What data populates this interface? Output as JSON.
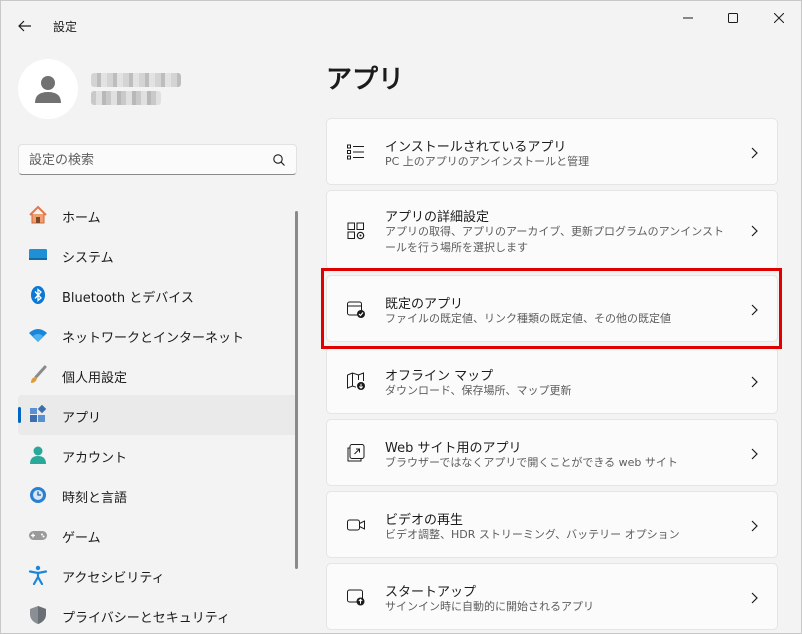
{
  "window": {
    "title": "設定"
  },
  "search": {
    "placeholder": "設定の検索"
  },
  "sidebar": {
    "items": [
      {
        "label": "ホーム",
        "icon": "home-icon"
      },
      {
        "label": "システム",
        "icon": "system-icon"
      },
      {
        "label": "Bluetooth とデバイス",
        "icon": "bluetooth-icon"
      },
      {
        "label": "ネットワークとインターネット",
        "icon": "wifi-icon"
      },
      {
        "label": "個人用設定",
        "icon": "brush-icon"
      },
      {
        "label": "アプリ",
        "icon": "apps-icon",
        "selected": true
      },
      {
        "label": "アカウント",
        "icon": "account-icon"
      },
      {
        "label": "時刻と言語",
        "icon": "clock-globe-icon"
      },
      {
        "label": "ゲーム",
        "icon": "gamepad-icon"
      },
      {
        "label": "アクセシビリティ",
        "icon": "accessibility-icon"
      },
      {
        "label": "プライバシーとセキュリティ",
        "icon": "shield-icon"
      }
    ]
  },
  "main": {
    "title": "アプリ",
    "cards": [
      {
        "title": "インストールされているアプリ",
        "desc": "PC 上のアプリのアンインストールと管理",
        "icon": "installed-apps-icon"
      },
      {
        "title": "アプリの詳細設定",
        "desc": "アプリの取得、アプリのアーカイブ、更新プログラムのアンインストールを行う場所を選択します",
        "icon": "advanced-app-settings-icon"
      },
      {
        "title": "既定のアプリ",
        "desc": "ファイルの既定値、リンク種類の既定値、その他の既定値",
        "icon": "default-apps-icon"
      },
      {
        "title": "オフライン マップ",
        "desc": "ダウンロード、保存場所、マップ更新",
        "icon": "offline-maps-icon"
      },
      {
        "title": "Web サイト用のアプリ",
        "desc": "ブラウザーではなくアプリで開くことができる web サイト",
        "icon": "apps-for-websites-icon"
      },
      {
        "title": "ビデオの再生",
        "desc": "ビデオ調整、HDR ストリーミング、バッテリー オプション",
        "icon": "video-camera-icon"
      },
      {
        "title": "スタートアップ",
        "desc": "サインイン時に自動的に開始されるアプリ",
        "icon": "startup-icon"
      }
    ]
  },
  "colors": {
    "accent": "#0067c0",
    "highlight": "#e00000",
    "background": "#f3f3f3",
    "card": "#fbfbfb"
  }
}
